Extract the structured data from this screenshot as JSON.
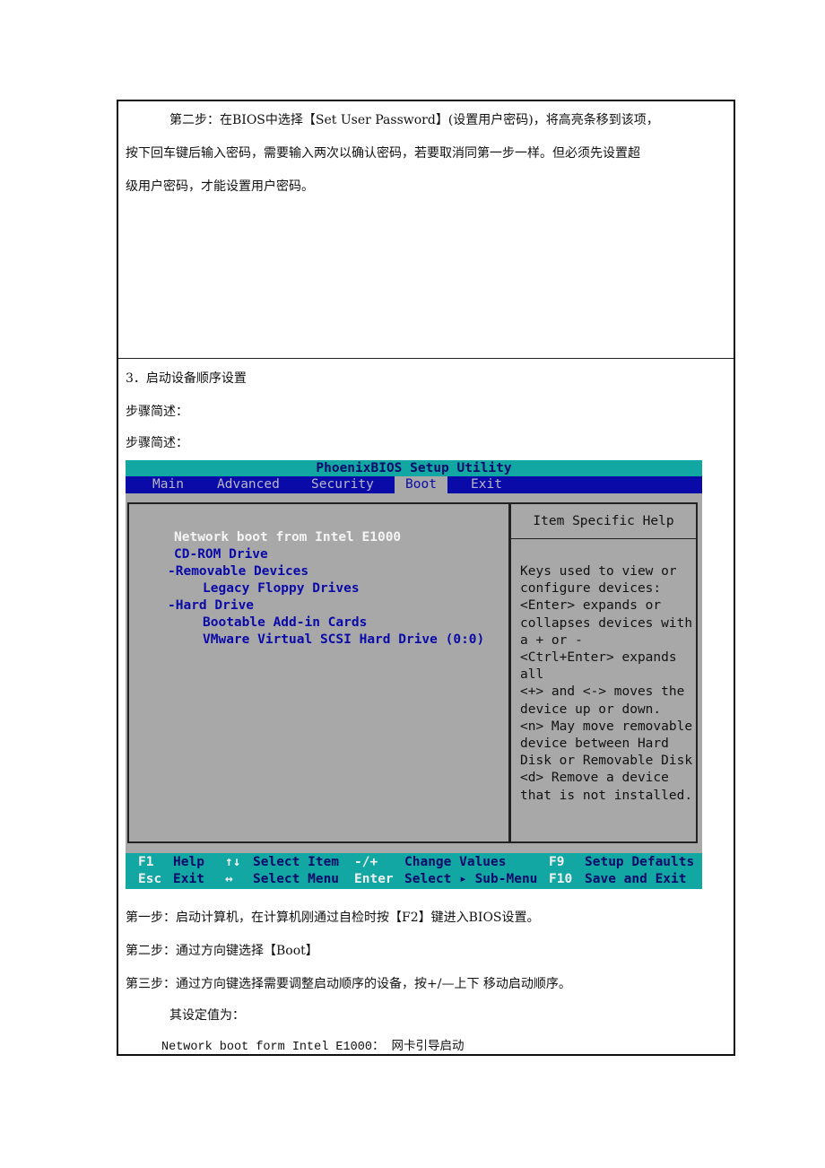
{
  "section_password": {
    "line1": "第二步：在BIOS中选择【Set    User Password】(设置用户密码)，将高亮条移到该项，",
    "line2": "按下回车键后输入密码，需要输入两次以确认密码，若要取消同第一步一样。但必须先设置超",
    "line3": "级用户密码，才能设置用户密码。"
  },
  "section_boot": {
    "heading": "3．启动设备顺序设置",
    "summary_label_1": "步骤简述：",
    "summary_label_2": "步骤简述：",
    "step1": "第一步：启动计算机，在计算机刚通过自检时按【F2】键进入BIOS设置。",
    "step2": "第二步：通过方向键选择【Boot】",
    "step3": "第三步：通过方向键选择需要调整启动顺序的设备，按+/—上下 移动启动顺序。",
    "settings_label": "其设定值为：",
    "setting_network": "Network boot form Intel E1000： 网卡引导启动"
  },
  "bios": {
    "title": "PhoenixBIOS Setup Utility",
    "menu": [
      {
        "label": "Main",
        "active": false
      },
      {
        "label": "Advanced",
        "active": false
      },
      {
        "label": "Security",
        "active": false
      },
      {
        "label": "Boot",
        "active": true
      },
      {
        "label": "Exit",
        "active": false
      }
    ],
    "boot_items": [
      {
        "label": "Network boot from Intel E1000",
        "selected": true
      },
      {
        "label": "CD-ROM Drive",
        "selected": false
      },
      {
        "label": "-Removable Devices",
        "selected": false
      },
      {
        "label": "Legacy Floppy Drives",
        "selected": false
      },
      {
        "label": "-Hard Drive",
        "selected": false
      },
      {
        "label": "Bootable Add-in Cards",
        "selected": false
      },
      {
        "label": "VMware Virtual SCSI Hard Drive (0:0)",
        "selected": false
      }
    ],
    "help_title": "Item Specific Help",
    "help_lines": [
      "Keys used to view or",
      "configure devices:",
      "<Enter> expands or",
      "collapses devices with",
      "a + or -",
      "<Ctrl+Enter> expands",
      "all",
      "<+> and <-> moves the",
      "device up or down.",
      "<n> May move removable",
      "device between Hard",
      "Disk or Removable Disk",
      "<d> Remove a device",
      "that is not installed."
    ],
    "footer": {
      "row1": [
        {
          "key": "F1",
          "desc": "Help"
        },
        {
          "key": "↑↓",
          "desc": "Select Item"
        },
        {
          "key": "-/+",
          "desc": "Change Values"
        },
        {
          "key": "F9",
          "desc": "Setup Defaults"
        }
      ],
      "row2": [
        {
          "key": "Esc",
          "desc": "Exit"
        },
        {
          "key": "↔",
          "desc": "Select Menu"
        },
        {
          "key": "Enter",
          "desc": "Select ▸ Sub-Menu"
        },
        {
          "key": "F10",
          "desc": "Save and Exit"
        }
      ]
    },
    "colors": {
      "title_bar": "#12a7a3",
      "menu_bar": "#0a0aa8",
      "panel_bg": "#a8a8a8",
      "item_text": "#0a0aa8",
      "selected_text": "#f4f4f4"
    }
  }
}
